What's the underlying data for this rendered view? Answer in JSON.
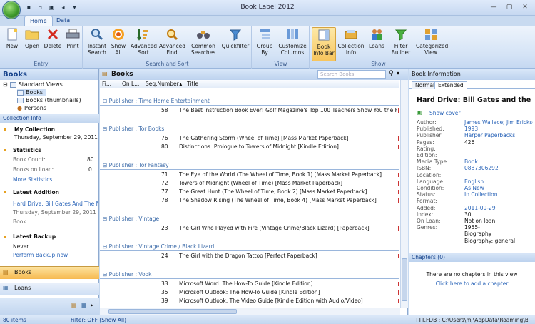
{
  "window": {
    "title": "Book Label 2012"
  },
  "ribbon": {
    "tabs": [
      "Home",
      "Data"
    ],
    "groups": {
      "entry": "Entry",
      "search_sort": "Search and Sort",
      "view": "View",
      "show": "Show"
    },
    "buttons": {
      "new": "New",
      "open": "Open",
      "delete": "Delete",
      "print": "Print",
      "instant_search": "Instant Search",
      "show_all": "Show All",
      "advanced_sort": "Advanced Sort",
      "advanced_find": "Advanced Find",
      "common_searches": "Common Searches",
      "quickfilter": "Quickfilter",
      "group_by": "Group By",
      "customize_columns": "Customize Columns",
      "book_info_bar": "Book Info Bar",
      "collection_info": "Collection Info",
      "loans": "Loans",
      "filter_builder": "Filter Builder",
      "categorized_view": "Categorized View"
    }
  },
  "left": {
    "title": "Books",
    "tree": [
      "Standard Views",
      "Books",
      "Books (thumbnails)",
      "Persons"
    ],
    "collection_info_header": "Collection Info",
    "my_collection": "My Collection",
    "my_collection_date": "Thursday, September 29, 2011",
    "statistics": "Statistics",
    "book_count_label": "Book Count:",
    "book_count": "80",
    "books_on_loan_label": "Books on Loan:",
    "books_on_loan": "0",
    "more_statistics": "More Statistics",
    "latest_addition": "Latest Addition",
    "latest_addition_title": "Hard Drive: Bill Gates And The Making",
    "latest_addition_date": "Thursday, September 29, 2011",
    "latest_addition_type": "Book",
    "latest_backup": "Latest Backup",
    "latest_backup_value": "Never",
    "perform_backup": "Perform Backup now",
    "nav_books": "Books",
    "nav_loans": "Loans"
  },
  "center": {
    "title": "Books",
    "search_placeholder": "Search Books",
    "columns": [
      "Fi...",
      "On L...",
      "Seq.Number",
      "Title"
    ],
    "groups": [
      {
        "publisher": "Publisher : Time Home Entertainment",
        "rows": [
          {
            "seq": "58",
            "title": "The Best Instruction Book Ever! Golf Magazine's Top 100 Teachers Show You the Fastest Ways to..."
          }
        ]
      },
      {
        "publisher": "Publisher : Tor Books",
        "rows": [
          {
            "seq": "76",
            "title": "The Gathering Storm (Wheel of Time) [Mass Market Paperback]"
          },
          {
            "seq": "80",
            "title": "Distinctions: Prologue to Towers of Midnight [Kindle Edition]"
          }
        ]
      },
      {
        "publisher": "Publisher : Tor Fantasy",
        "rows": [
          {
            "seq": "71",
            "title": "The Eye of the World (The Wheel of Time, Book 1) [Mass Market Paperback]"
          },
          {
            "seq": "72",
            "title": "Towers of Midnight (Wheel of Time) [Mass Market Paperback]"
          },
          {
            "seq": "77",
            "title": "The Great Hunt (The Wheel of Time, Book 2) [Mass Market Paperback]"
          },
          {
            "seq": "78",
            "title": "The Shadow Rising (The Wheel of Time, Book 4) [Mass Market Paperback]"
          }
        ]
      },
      {
        "publisher": "Publisher : Vintage",
        "rows": [
          {
            "seq": "23",
            "title": "The Girl Who Played with Fire (Vintage Crime/Black Lizard) [Paperback]"
          }
        ]
      },
      {
        "publisher": "Publisher : Vintage Crime / Black Lizard",
        "rows": [
          {
            "seq": "24",
            "title": "The Girl with the Dragon Tattoo [Perfect Paperback]"
          }
        ]
      },
      {
        "publisher": "Publisher : Vook",
        "rows": [
          {
            "seq": "33",
            "title": "Microsoft Word: The How-To Guide [Kindle Edition]"
          },
          {
            "seq": "35",
            "title": "Microsoft Outlook: The How-To Guide [Kindle Edition]"
          },
          {
            "seq": "39",
            "title": "Microsoft Outlook: The Video Guide [Kindle Edition with Audio/Video]"
          }
        ]
      }
    ]
  },
  "right": {
    "title": "Book Information",
    "tabs": [
      "Normal",
      "Extended"
    ],
    "book_title": "Hard Drive: Bill Gates and the Making",
    "show_cover": "Show cover",
    "fields": [
      {
        "label": "Author:",
        "value": "James Wallace; Jim Erickson",
        "link": true
      },
      {
        "label": "Published:",
        "value": "1993",
        "link": true
      },
      {
        "label": "Publisher:",
        "value": "Harper Paperbacks",
        "link": true
      },
      {
        "label": "Pages:",
        "value": "426",
        "link": false
      },
      {
        "label": "Rating:",
        "value": "",
        "link": false
      },
      {
        "label": "Edition:",
        "value": "",
        "link": false
      },
      {
        "label": "Media Type:",
        "value": "Book",
        "link": true
      },
      {
        "label": "ISBN:",
        "value": "0887306292",
        "link": true
      },
      {
        "label": "Location:",
        "value": "",
        "link": false
      },
      {
        "label": "Language:",
        "value": "English",
        "link": true
      },
      {
        "label": "Condition:",
        "value": "As New",
        "link": true
      },
      {
        "label": "Status:",
        "value": "In Collection",
        "link": true
      },
      {
        "label": "Format:",
        "value": "",
        "link": false
      },
      {
        "label": "Added:",
        "value": "2011-09-29",
        "link": true
      },
      {
        "label": "Index:",
        "value": "30",
        "link": false
      },
      {
        "label": "On Loan:",
        "value": "Not on loan",
        "link": false
      },
      {
        "label": "Genres:",
        "value": "1955-",
        "link": false
      },
      {
        "label": "",
        "value": "Biography",
        "link": false
      },
      {
        "label": "",
        "value": "Biography: general",
        "link": false
      }
    ],
    "chapters_header": "Chapters (0)",
    "no_chapters": "There are no chapters in this view",
    "add_chapter": "Click here to add a chapter"
  },
  "status": {
    "items": "80 items",
    "filter": "Filter: OFF (Show All)",
    "path": "TTT.FDB : C:\\Users\\mj\\AppData\\Roaming\\Boo"
  }
}
